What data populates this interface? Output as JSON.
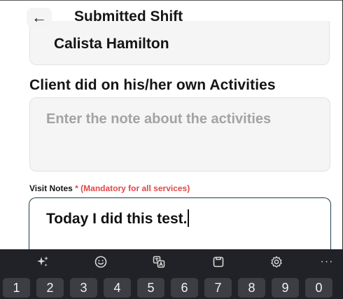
{
  "header": {
    "back_icon": "arrow-left-icon",
    "back_glyph": "←",
    "title": "Submitted Shift"
  },
  "client": {
    "name": "Calista Hamilton"
  },
  "activities": {
    "label": "Client did on his/her own Activities",
    "placeholder": "Enter the note about the activities",
    "value": ""
  },
  "visit_notes": {
    "label": "Visit Notes",
    "required_marker": "* (Mandatory for all services)",
    "value": "Today I did this test."
  },
  "keyboard": {
    "toolbar_icons": [
      "sparkle-icon",
      "emoji-icon",
      "translate-icon",
      "clipboard-icon",
      "settings-icon",
      "more-icon"
    ],
    "more_glyph": "···",
    "number_keys": [
      "1",
      "2",
      "3",
      "4",
      "5",
      "6",
      "7",
      "8",
      "9",
      "0"
    ]
  },
  "colors": {
    "required_red": "#e0474a",
    "focused_border": "#1f3d4d",
    "keyboard_bg": "#202227",
    "key_bg": "#3c3e44",
    "input_bg": "#f5f5f6"
  }
}
